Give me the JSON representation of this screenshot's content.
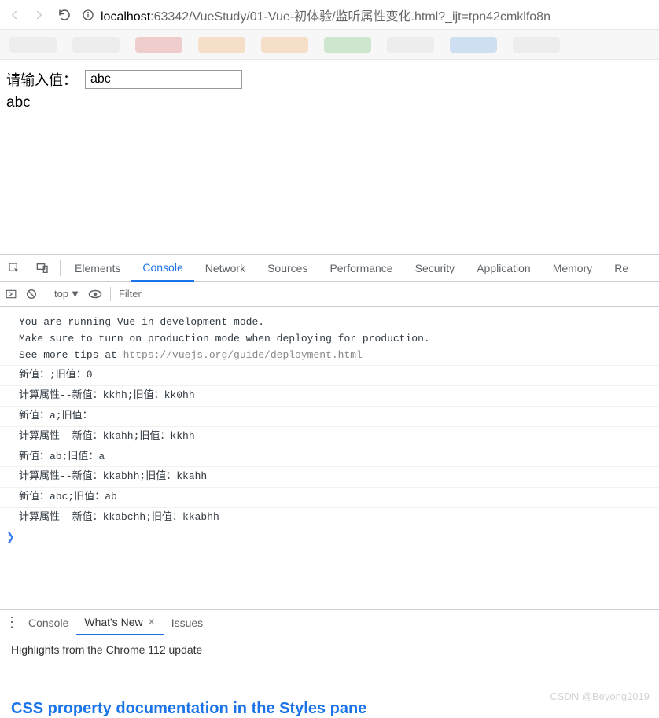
{
  "url": {
    "host": "localhost",
    "port_path": ":63342/VueStudy/01-Vue-初体验/监听属性变化.html?_ijt=tpn42cmklfo8n"
  },
  "page": {
    "label": "请输入值：",
    "input_value": "abc",
    "output": "abc"
  },
  "devtools": {
    "tabs": [
      "Elements",
      "Console",
      "Network",
      "Sources",
      "Performance",
      "Security",
      "Application",
      "Memory",
      "Re"
    ],
    "active_tab": "Console",
    "context": "top",
    "filter_placeholder": "Filter"
  },
  "console_messages": [
    {
      "type": "group",
      "text": "You are running Vue in development mode.\nMake sure to turn on production mode when deploying for production.\nSee more tips at ",
      "link": "https://vuejs.org/guide/deployment.html"
    },
    {
      "type": "log",
      "text": "新值：;旧值：0"
    },
    {
      "type": "log",
      "text": "计算属性--新值：kkhh;旧值：kk0hh"
    },
    {
      "type": "log",
      "text": "新值：a;旧值："
    },
    {
      "type": "log",
      "text": "计算属性--新值：kkahh;旧值：kkhh"
    },
    {
      "type": "log",
      "text": "新值：ab;旧值：a"
    },
    {
      "type": "log",
      "text": "计算属性--新值：kkabhh;旧值：kkahh"
    },
    {
      "type": "log",
      "text": "新值：abc;旧值：ab"
    },
    {
      "type": "log",
      "text": "计算属性--新值：kkabchh;旧值：kkabhh"
    }
  ],
  "prompt": "❯",
  "drawer": {
    "tabs": [
      "Console",
      "What's New",
      "Issues"
    ],
    "active": "What's New",
    "highlights": "Highlights from the Chrome 112 update",
    "headline": "CSS property documentation in the Styles pane"
  },
  "watermark": "CSDN @Beyong2019"
}
